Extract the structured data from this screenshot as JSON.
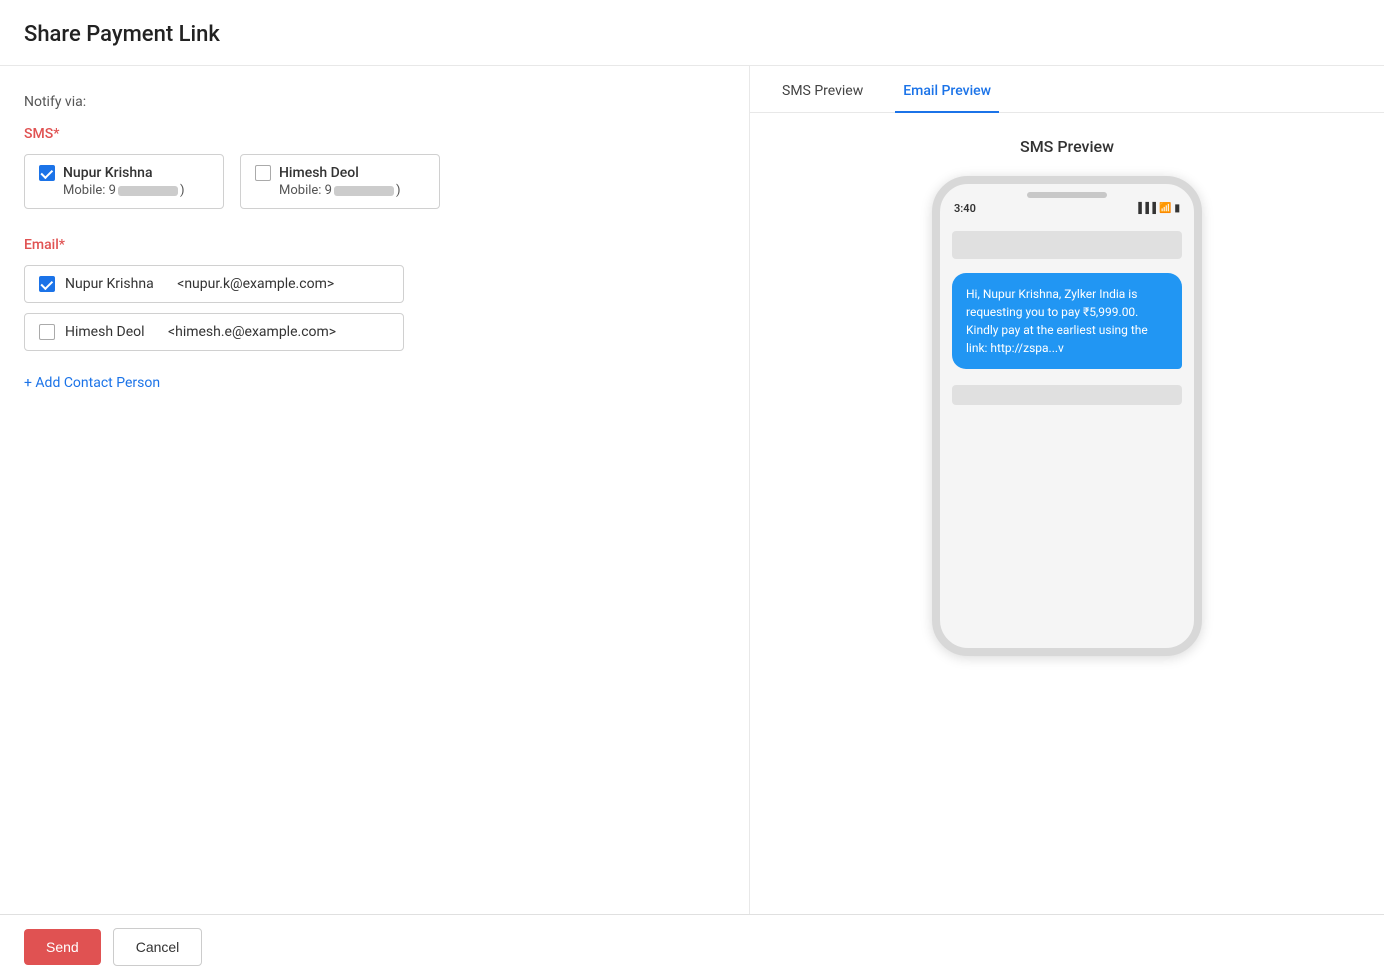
{
  "page": {
    "title": "Share Payment Link"
  },
  "notify": {
    "label": "Notify via:"
  },
  "sms": {
    "label": "SMS*",
    "contacts": [
      {
        "name": "Nupur Krishna",
        "mobile_prefix": "Mobile: 9",
        "mobile_suffix": ")",
        "checked": true
      },
      {
        "name": "Himesh Deol",
        "mobile_prefix": "Mobile: 9",
        "mobile_suffix": ")",
        "checked": false
      }
    ]
  },
  "email": {
    "label": "Email*",
    "contacts": [
      {
        "name": "Nupur Krishna",
        "email": "<nupur.k@example.com>",
        "checked": true
      },
      {
        "name": "Himesh Deol",
        "email": "<himesh.e@example.com>",
        "checked": false
      }
    ],
    "add_contact_label": "+ Add Contact Person"
  },
  "tabs": {
    "sms_preview": "SMS Preview",
    "email_preview": "Email Preview",
    "active": "sms"
  },
  "preview": {
    "title": "SMS Preview",
    "phone_time": "3:40",
    "sms_message": "Hi, Nupur Krishna,\nZylker India is requesting you to pay ₹5,999.00. Kindly pay at the earliest using the link: http://zspa...v"
  },
  "footer": {
    "send_label": "Send",
    "cancel_label": "Cancel"
  }
}
